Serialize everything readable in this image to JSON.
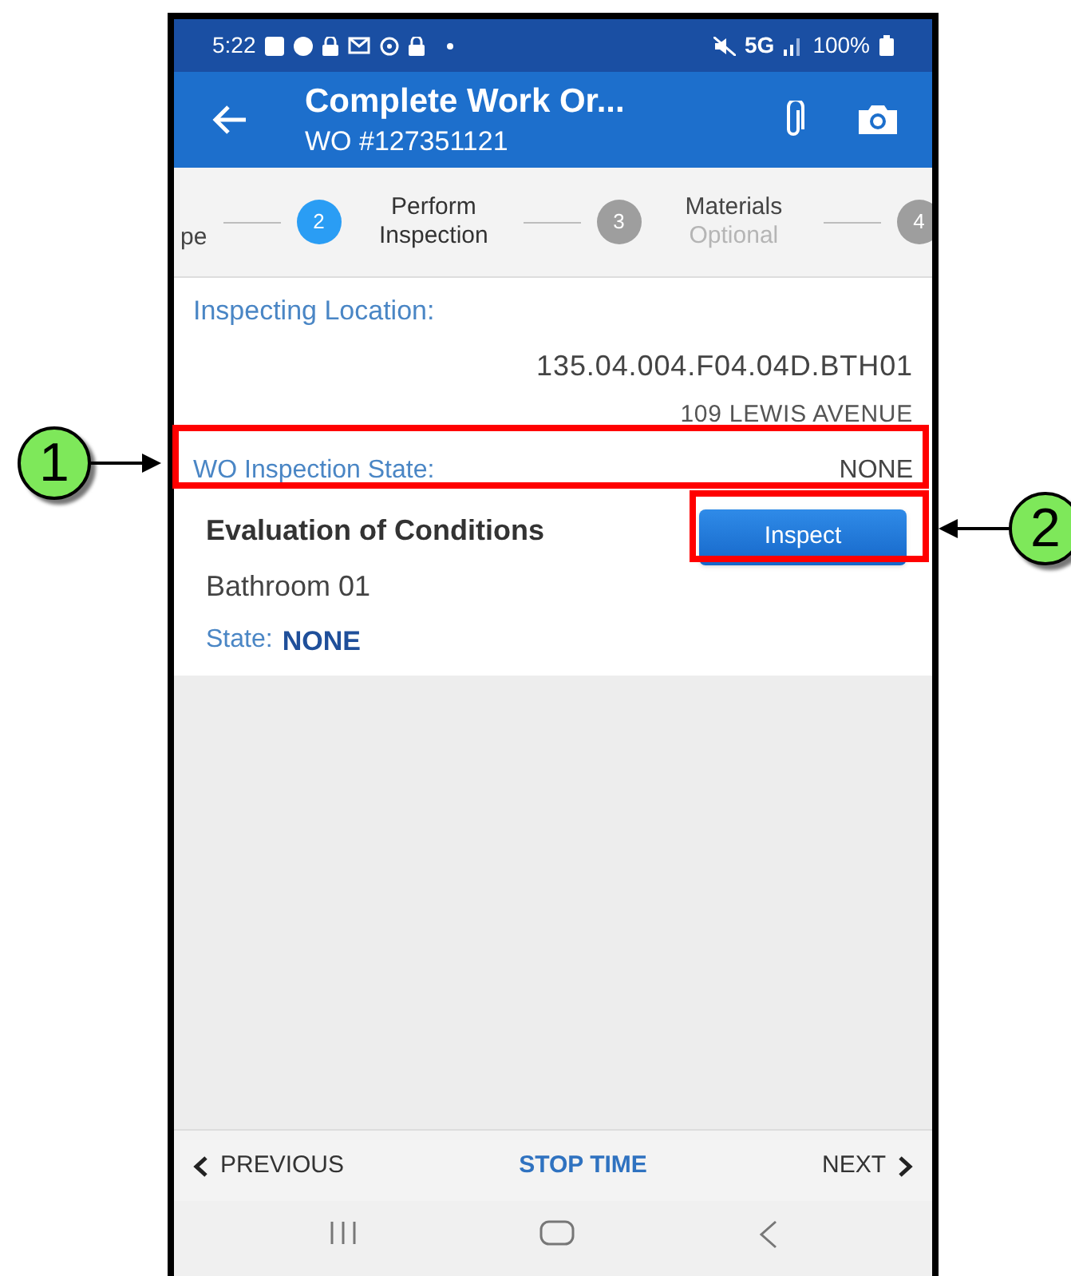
{
  "status_bar": {
    "time": "5:22",
    "network": "5G",
    "battery": "100%"
  },
  "app_bar": {
    "title": "Complete Work Or...",
    "subtitle": "WO #127351121"
  },
  "steps": [
    {
      "label": "pe",
      "selected": false
    },
    {
      "number": "2",
      "label": "Perform Inspection",
      "selected": true
    },
    {
      "number": "3",
      "label": "Materials",
      "sublabel": "Optional",
      "selected": false
    },
    {
      "number": "4",
      "selected": false
    }
  ],
  "location": {
    "label": "Inspecting Location:",
    "code": "135.04.004.F04.04D.BTH01",
    "address": "109 LEWIS AVENUE"
  },
  "inspection_state": {
    "label": "WO Inspection State:",
    "value": "NONE"
  },
  "evaluation": {
    "title": "Evaluation of Conditions",
    "room": "Bathroom 01",
    "state_label": "State:",
    "state_value": "NONE",
    "button": "Inspect"
  },
  "bottom_nav": {
    "previous": "PREVIOUS",
    "center": "STOP TIME",
    "next": "NEXT"
  },
  "callouts": [
    {
      "number": "1"
    },
    {
      "number": "2"
    }
  ]
}
